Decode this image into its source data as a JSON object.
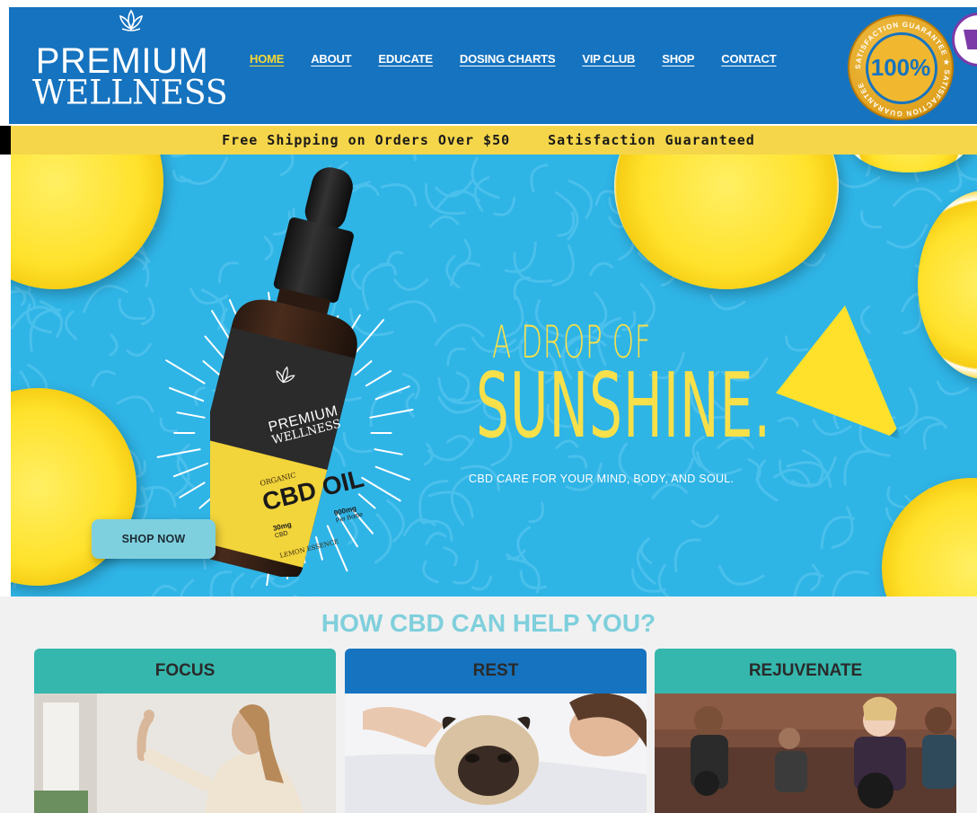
{
  "brand": {
    "line1": "PREMIUM",
    "line2": "WELLNESS"
  },
  "nav": [
    {
      "label": "HOME",
      "active": true
    },
    {
      "label": "ABOUT",
      "active": false
    },
    {
      "label": "EDUCATE",
      "active": false
    },
    {
      "label": "DOSING CHARTS",
      "active": false
    },
    {
      "label": "VIP CLUB",
      "active": false
    },
    {
      "label": "SHOP",
      "active": false
    },
    {
      "label": "CONTACT",
      "active": false
    }
  ],
  "badge": {
    "value": "100%",
    "ring_text": "SATISFACTION GUARANTEE"
  },
  "promo": {
    "left": "Free Shipping on Orders Over $50",
    "right": "Satisfaction Guaranteed"
  },
  "hero": {
    "headline_small": "A DROP OF",
    "headline_big": "SUNSHINE.",
    "subhead": "CBD CARE FOR YOUR MIND, BODY, AND SOUL.",
    "cta": "SHOP NOW",
    "bottle": {
      "brand1": "PREMIUM",
      "brand2": "WELLNESS",
      "organic": "ORGANIC",
      "product": "CBD OIL",
      "dose_left": "30mg",
      "dose_left_unit": "CBD",
      "dose_right": "900mg",
      "dose_right_unit": "Per Bottle",
      "flavor": "LEMON ESSENCE"
    }
  },
  "section": {
    "title": "HOW CBD CAN HELP YOU?",
    "cards": [
      {
        "label": "FOCUS",
        "color": "#35b7ad"
      },
      {
        "label": "REST",
        "color": "#1673bf"
      },
      {
        "label": "REJUVENATE",
        "color": "#35b7ad"
      }
    ]
  },
  "colors": {
    "header": "#1673bf",
    "promo": "#f5d64a",
    "accent_yellow": "#f6d735",
    "hero_bg": "#2fb4e6",
    "teal": "#35b7ad",
    "title_teal": "#7fcfdc"
  }
}
